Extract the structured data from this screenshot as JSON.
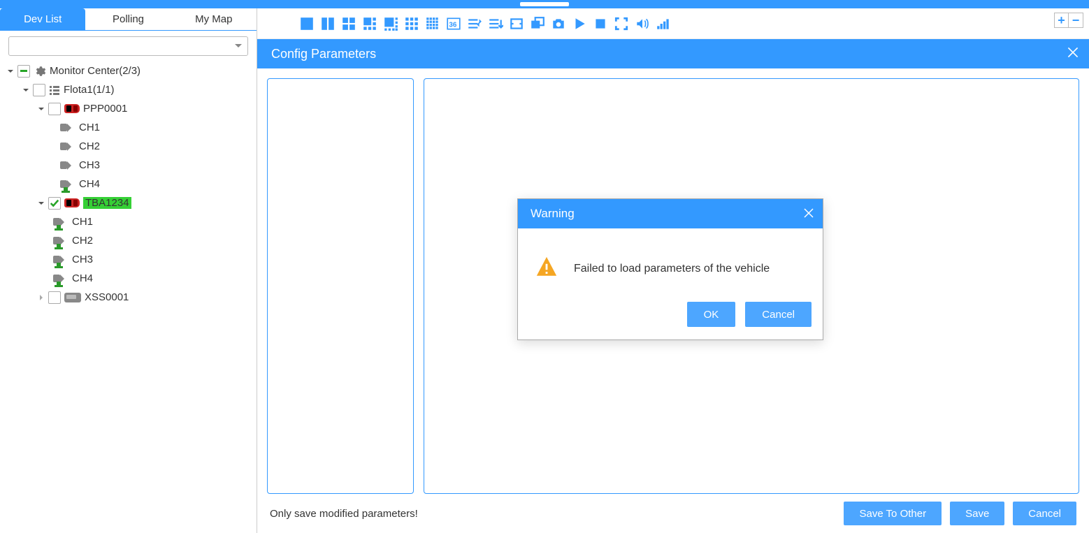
{
  "tabs": {
    "devlist": "Dev List",
    "polling": "Polling",
    "mymap": "My Map"
  },
  "tree": {
    "root": "Monitor Center(2/3)",
    "fleet": "Flota1(1/1)",
    "veh1": "PPP0001",
    "veh1_ch": [
      "CH1",
      "CH2",
      "CH3",
      "CH4"
    ],
    "veh2": "TBA1234",
    "veh2_ch": [
      "CH1",
      "CH2",
      "CH3",
      "CH4"
    ],
    "veh3": "XSS0001"
  },
  "config": {
    "title": "Config Parameters",
    "footer_note": "Only save modified parameters!",
    "save_to_other": "Save To Other",
    "save": "Save",
    "cancel": "Cancel"
  },
  "modal": {
    "title": "Warning",
    "message": "Failed to load parameters of the vehicle",
    "ok": "OK",
    "cancel": "Cancel"
  },
  "zoom": {
    "plus": "+",
    "minus": "−"
  }
}
